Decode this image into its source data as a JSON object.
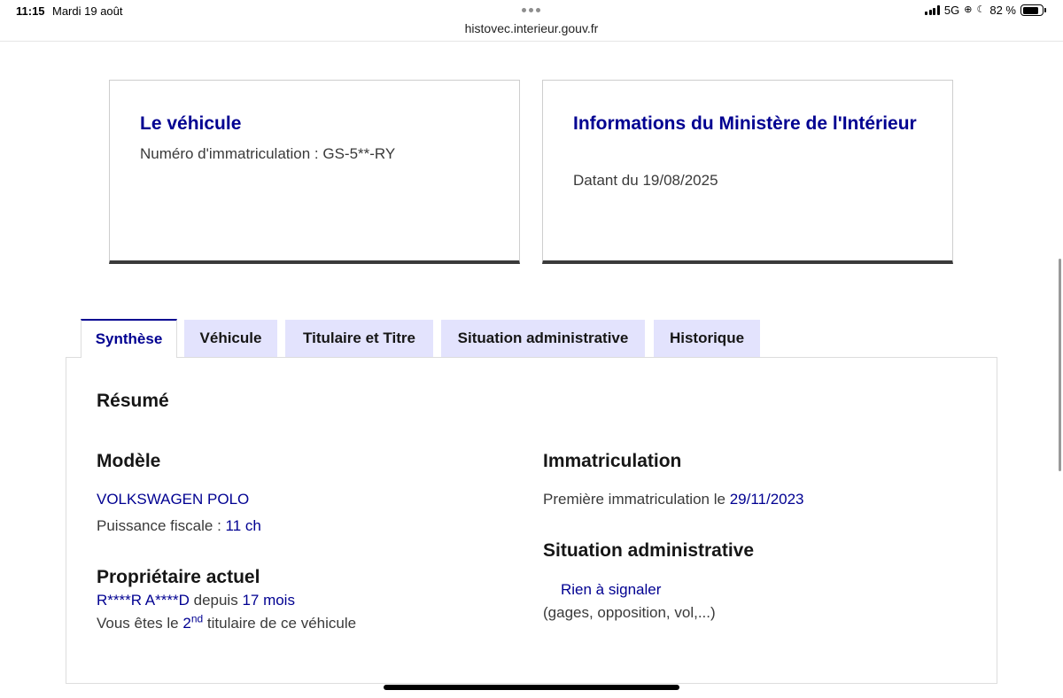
{
  "status_bar": {
    "time": "11:15",
    "date": "Mardi 19 août",
    "network": "5G",
    "battery": "82 %",
    "battery_level": 0.82
  },
  "browser": {
    "url": "histovec.interieur.gouv.fr"
  },
  "cards": {
    "vehicle": {
      "title": "Le véhicule",
      "description": "Numéro d'immatriculation : GS-5**-RY"
    },
    "ministry": {
      "title": "Informations du Ministère de l'Intérieur",
      "description": "Datant du 19/08/2025"
    }
  },
  "tabs": [
    {
      "label": "Synthèse",
      "active": true
    },
    {
      "label": "Véhicule",
      "active": false
    },
    {
      "label": "Titulaire et Titre",
      "active": false
    },
    {
      "label": "Situation administrative",
      "active": false
    },
    {
      "label": "Historique",
      "active": false
    }
  ],
  "summary": {
    "title": "Résumé",
    "model": {
      "title": "Modèle",
      "name": "VOLKSWAGEN POLO",
      "power_label": "Puissance fiscale : ",
      "power_value": "11 ch"
    },
    "owner": {
      "title": "Propriétaire actuel",
      "name": "R****R A****D",
      "since_label": " depuis ",
      "since_value": "17 mois",
      "holder_prefix": "Vous êtes le ",
      "holder_rank": "2",
      "holder_rank_suffix": "nd",
      "holder_suffix": " titulaire de ce véhicule"
    },
    "registration": {
      "title": "Immatriculation",
      "first_label": "Première immatriculation le ",
      "first_date": "29/11/2023"
    },
    "admin": {
      "title": "Situation administrative",
      "status": "Rien à signaler",
      "details": "(gages, opposition, vol,...)"
    }
  },
  "colors": {
    "primary": "#000091",
    "tab_background": "#e3e3fd",
    "text": "#161616",
    "muted_text": "#3a3a3a"
  }
}
